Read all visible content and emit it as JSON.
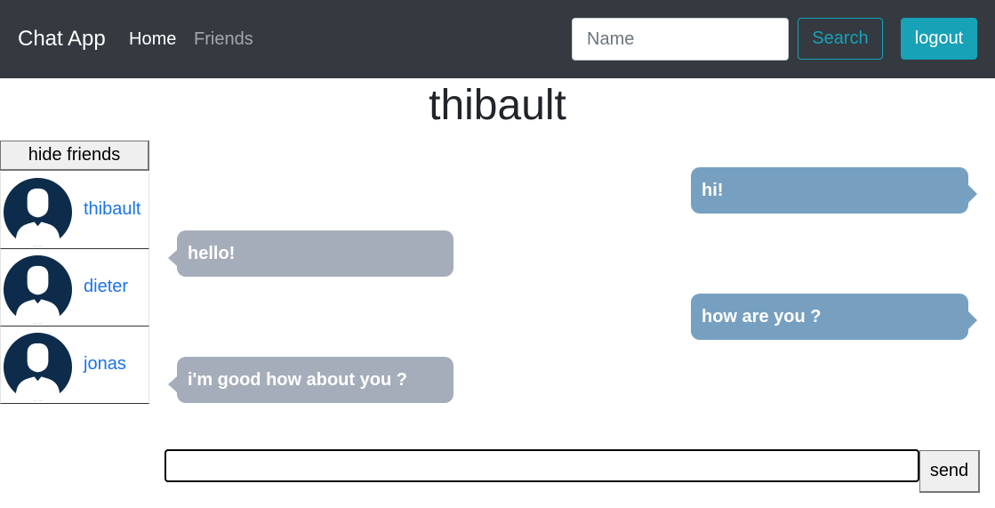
{
  "navbar": {
    "brand": "Chat App",
    "links": [
      {
        "label": "Home",
        "active": true
      },
      {
        "label": "Friends",
        "active": false
      }
    ],
    "search": {
      "placeholder": "Name",
      "value": "",
      "button_label": "Search"
    },
    "logout_label": "logout"
  },
  "chat": {
    "title": "thibault",
    "messages": [
      {
        "text": "hi!",
        "direction": "sent"
      },
      {
        "text": "hello!",
        "direction": "received"
      },
      {
        "text": "how are you ?",
        "direction": "sent"
      },
      {
        "text": "i'm good how about you ?",
        "direction": "received"
      }
    ],
    "input_value": "",
    "send_label": "send"
  },
  "friends": {
    "toggle_label": "hide friends",
    "items": [
      {
        "name": "thibault",
        "icon": "user-avatar-icon"
      },
      {
        "name": "dieter",
        "icon": "user-avatar-icon"
      },
      {
        "name": "jonas",
        "icon": "user-avatar-icon"
      }
    ]
  },
  "colors": {
    "navbar_bg": "#343a40",
    "accent": "#17a2b8",
    "sent_bubble": "#77a0c0",
    "received_bubble": "#a6adba",
    "avatar": "#0d2c4b",
    "link": "#1a73e8"
  }
}
